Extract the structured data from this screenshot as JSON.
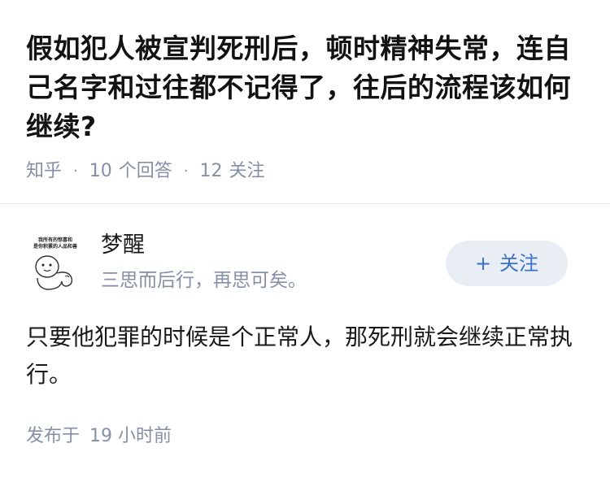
{
  "question": {
    "title": "假如犯人被宣判死刑后，顿时精神失常，连自己名字和过往都不记得了，往后的流程该如何继续?",
    "source": "知乎",
    "separator": "·",
    "answer_count": "10",
    "answer_label": "个回答",
    "follow_count": "12",
    "follow_label": "关注"
  },
  "author": {
    "name": "梦醒",
    "bio": "三思而后行，再思可矣。",
    "avatar_icon": "cartoon-sticker-avatar",
    "avatar_text": "我所有的惊喜和 是你积累的人品和善"
  },
  "follow_button": {
    "icon": "+",
    "label": "关注"
  },
  "answer": {
    "body": "只要他犯罪的时候是个正常人，那死刑就会继续正常执行。",
    "time_label": "发布于",
    "time_value": "19 小时前"
  },
  "colors": {
    "meta_gray": "#8590a6",
    "follow_bg": "#e9eef5",
    "follow_text": "#3970c9",
    "title": "#121212"
  }
}
